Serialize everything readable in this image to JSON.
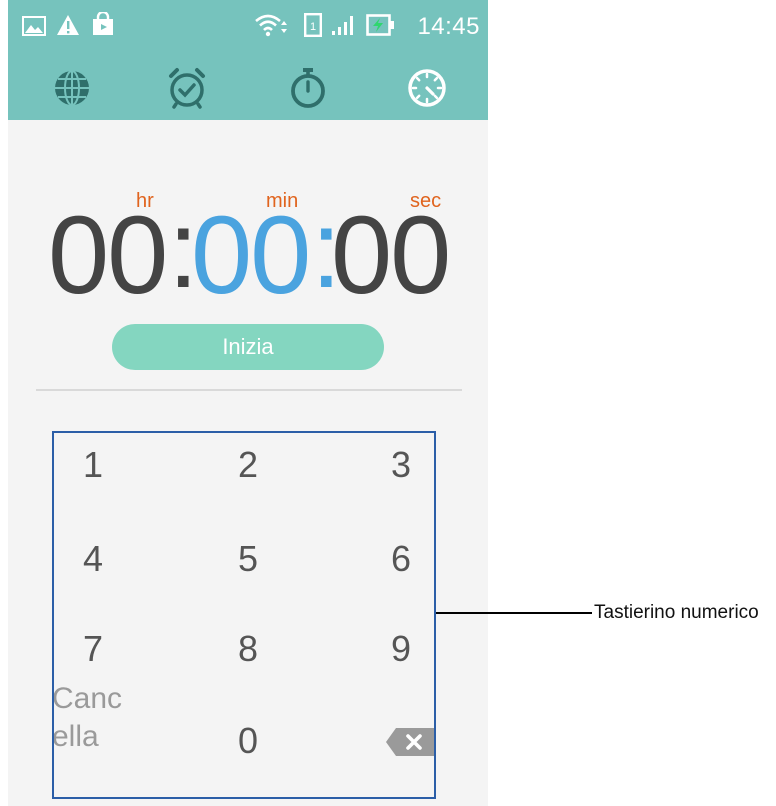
{
  "status_bar": {
    "time": "14:45",
    "left_icons": [
      "image-icon",
      "warning-icon",
      "shopping-bag-icon"
    ],
    "right_icons": [
      "wifi-icon",
      "sim-icon",
      "signal-icon",
      "battery-charging-icon"
    ]
  },
  "tabs": [
    {
      "name": "world-clock",
      "icon": "globe-icon"
    },
    {
      "name": "alarm",
      "icon": "alarm-clock-icon"
    },
    {
      "name": "stopwatch",
      "icon": "stopwatch-icon"
    },
    {
      "name": "timer",
      "icon": "timer-icon",
      "selected": true
    }
  ],
  "timer": {
    "hours": "00",
    "minutes": "00",
    "seconds": "00",
    "separator": ":",
    "unit_hr": "hr",
    "unit_min": "min",
    "unit_sec": "sec",
    "start_label": "Inizia"
  },
  "keypad": {
    "keys": [
      "1",
      "2",
      "3",
      "4",
      "5",
      "6",
      "7",
      "8",
      "9"
    ],
    "zero": "0",
    "cancel_line1": "Canc",
    "cancel_line2": "ella",
    "backspace_icon": "backspace-icon"
  },
  "callout": {
    "label": "Tastierino numerico"
  },
  "colors": {
    "bar": "#76c3bd",
    "accent_blue": "#4aa3df",
    "unit_orange": "#e0641e",
    "button": "#84d6c0",
    "frame": "#2b5ea7"
  }
}
